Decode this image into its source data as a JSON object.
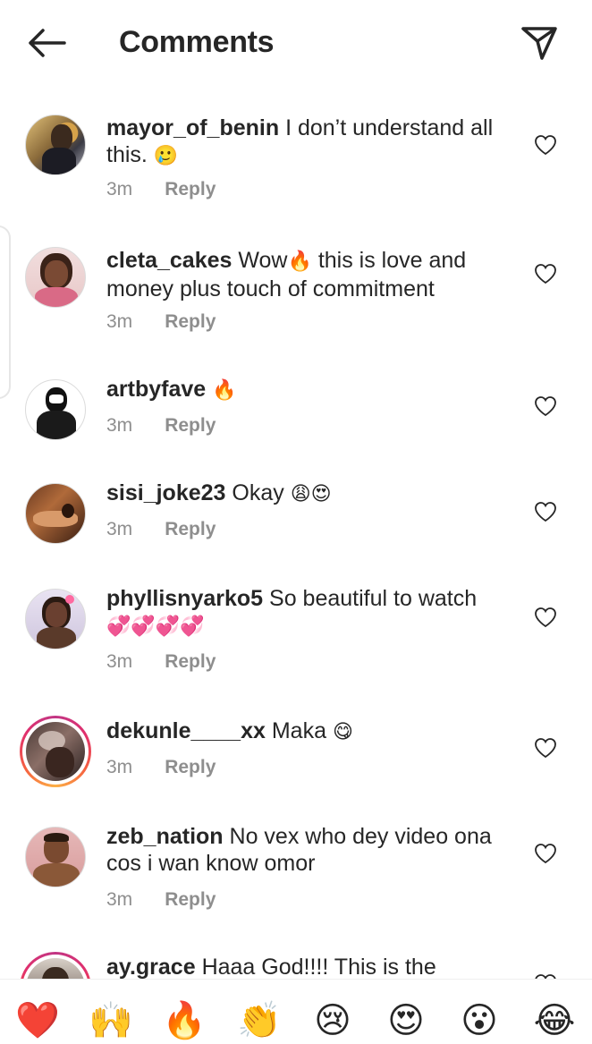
{
  "header": {
    "title": "Comments",
    "back_icon": "arrow-left-icon",
    "share_icon": "paper-plane-icon"
  },
  "comments": [
    {
      "username": "mayor_of_benin",
      "text": "I don’t understand all this.",
      "emoji": "🥲",
      "time": "3m",
      "reply": "Reply"
    },
    {
      "username": "cleta_cakes",
      "text_before": "Wow",
      "emoji_mid": "🔥",
      "text": "this is love and money plus touch of commitment",
      "time": "3m",
      "reply": "Reply"
    },
    {
      "username": "artbyfave",
      "text": "",
      "emoji": "🔥",
      "time": "3m",
      "reply": "Reply"
    },
    {
      "username": "sisi_joke23",
      "text": "Okay",
      "emoji": "😩😍",
      "time": "3m",
      "reply": "Reply"
    },
    {
      "username": "phyllisnyarko5",
      "text": "So beautiful to watch",
      "emoji": "💞💞💞💞",
      "time": "3m",
      "reply": "Reply"
    },
    {
      "username": "dekunle____xx",
      "text": "Maka",
      "emoji": "😋",
      "time": "3m",
      "reply": "Reply"
    },
    {
      "username": "zeb_nation",
      "text": "No vex who dey video ona cos i wan know omor",
      "emoji": "",
      "time": "3m",
      "reply": "Reply"
    },
    {
      "username": "ay.grace",
      "text": "Haaa God!!!! This is the",
      "emoji": "",
      "time": "",
      "reply": ""
    }
  ],
  "reactions": [
    "❤️",
    "🙌",
    "🔥",
    "👏",
    "😢",
    "😍",
    "😮",
    "😂"
  ],
  "colors": {
    "text": "#262626",
    "muted": "#8e8e8e",
    "story_ring": "#e1306c"
  }
}
